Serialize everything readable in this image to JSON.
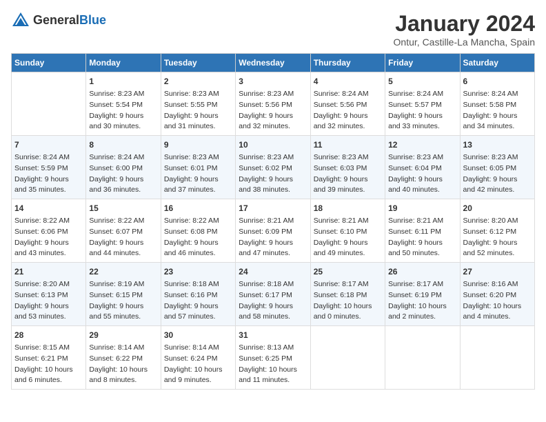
{
  "header": {
    "logo_general": "General",
    "logo_blue": "Blue",
    "title": "January 2024",
    "subtitle": "Ontur, Castille-La Mancha, Spain"
  },
  "calendar": {
    "weekdays": [
      "Sunday",
      "Monday",
      "Tuesday",
      "Wednesday",
      "Thursday",
      "Friday",
      "Saturday"
    ],
    "weeks": [
      [
        {
          "day": "",
          "content": ""
        },
        {
          "day": "1",
          "content": "Sunrise: 8:23 AM\nSunset: 5:54 PM\nDaylight: 9 hours\nand 30 minutes."
        },
        {
          "day": "2",
          "content": "Sunrise: 8:23 AM\nSunset: 5:55 PM\nDaylight: 9 hours\nand 31 minutes."
        },
        {
          "day": "3",
          "content": "Sunrise: 8:23 AM\nSunset: 5:56 PM\nDaylight: 9 hours\nand 32 minutes."
        },
        {
          "day": "4",
          "content": "Sunrise: 8:24 AM\nSunset: 5:56 PM\nDaylight: 9 hours\nand 32 minutes."
        },
        {
          "day": "5",
          "content": "Sunrise: 8:24 AM\nSunset: 5:57 PM\nDaylight: 9 hours\nand 33 minutes."
        },
        {
          "day": "6",
          "content": "Sunrise: 8:24 AM\nSunset: 5:58 PM\nDaylight: 9 hours\nand 34 minutes."
        }
      ],
      [
        {
          "day": "7",
          "content": "Sunrise: 8:24 AM\nSunset: 5:59 PM\nDaylight: 9 hours\nand 35 minutes."
        },
        {
          "day": "8",
          "content": "Sunrise: 8:24 AM\nSunset: 6:00 PM\nDaylight: 9 hours\nand 36 minutes."
        },
        {
          "day": "9",
          "content": "Sunrise: 8:23 AM\nSunset: 6:01 PM\nDaylight: 9 hours\nand 37 minutes."
        },
        {
          "day": "10",
          "content": "Sunrise: 8:23 AM\nSunset: 6:02 PM\nDaylight: 9 hours\nand 38 minutes."
        },
        {
          "day": "11",
          "content": "Sunrise: 8:23 AM\nSunset: 6:03 PM\nDaylight: 9 hours\nand 39 minutes."
        },
        {
          "day": "12",
          "content": "Sunrise: 8:23 AM\nSunset: 6:04 PM\nDaylight: 9 hours\nand 40 minutes."
        },
        {
          "day": "13",
          "content": "Sunrise: 8:23 AM\nSunset: 6:05 PM\nDaylight: 9 hours\nand 42 minutes."
        }
      ],
      [
        {
          "day": "14",
          "content": "Sunrise: 8:22 AM\nSunset: 6:06 PM\nDaylight: 9 hours\nand 43 minutes."
        },
        {
          "day": "15",
          "content": "Sunrise: 8:22 AM\nSunset: 6:07 PM\nDaylight: 9 hours\nand 44 minutes."
        },
        {
          "day": "16",
          "content": "Sunrise: 8:22 AM\nSunset: 6:08 PM\nDaylight: 9 hours\nand 46 minutes."
        },
        {
          "day": "17",
          "content": "Sunrise: 8:21 AM\nSunset: 6:09 PM\nDaylight: 9 hours\nand 47 minutes."
        },
        {
          "day": "18",
          "content": "Sunrise: 8:21 AM\nSunset: 6:10 PM\nDaylight: 9 hours\nand 49 minutes."
        },
        {
          "day": "19",
          "content": "Sunrise: 8:21 AM\nSunset: 6:11 PM\nDaylight: 9 hours\nand 50 minutes."
        },
        {
          "day": "20",
          "content": "Sunrise: 8:20 AM\nSunset: 6:12 PM\nDaylight: 9 hours\nand 52 minutes."
        }
      ],
      [
        {
          "day": "21",
          "content": "Sunrise: 8:20 AM\nSunset: 6:13 PM\nDaylight: 9 hours\nand 53 minutes."
        },
        {
          "day": "22",
          "content": "Sunrise: 8:19 AM\nSunset: 6:15 PM\nDaylight: 9 hours\nand 55 minutes."
        },
        {
          "day": "23",
          "content": "Sunrise: 8:18 AM\nSunset: 6:16 PM\nDaylight: 9 hours\nand 57 minutes."
        },
        {
          "day": "24",
          "content": "Sunrise: 8:18 AM\nSunset: 6:17 PM\nDaylight: 9 hours\nand 58 minutes."
        },
        {
          "day": "25",
          "content": "Sunrise: 8:17 AM\nSunset: 6:18 PM\nDaylight: 10 hours\nand 0 minutes."
        },
        {
          "day": "26",
          "content": "Sunrise: 8:17 AM\nSunset: 6:19 PM\nDaylight: 10 hours\nand 2 minutes."
        },
        {
          "day": "27",
          "content": "Sunrise: 8:16 AM\nSunset: 6:20 PM\nDaylight: 10 hours\nand 4 minutes."
        }
      ],
      [
        {
          "day": "28",
          "content": "Sunrise: 8:15 AM\nSunset: 6:21 PM\nDaylight: 10 hours\nand 6 minutes."
        },
        {
          "day": "29",
          "content": "Sunrise: 8:14 AM\nSunset: 6:22 PM\nDaylight: 10 hours\nand 8 minutes."
        },
        {
          "day": "30",
          "content": "Sunrise: 8:14 AM\nSunset: 6:24 PM\nDaylight: 10 hours\nand 9 minutes."
        },
        {
          "day": "31",
          "content": "Sunrise: 8:13 AM\nSunset: 6:25 PM\nDaylight: 10 hours\nand 11 minutes."
        },
        {
          "day": "",
          "content": ""
        },
        {
          "day": "",
          "content": ""
        },
        {
          "day": "",
          "content": ""
        }
      ]
    ]
  }
}
